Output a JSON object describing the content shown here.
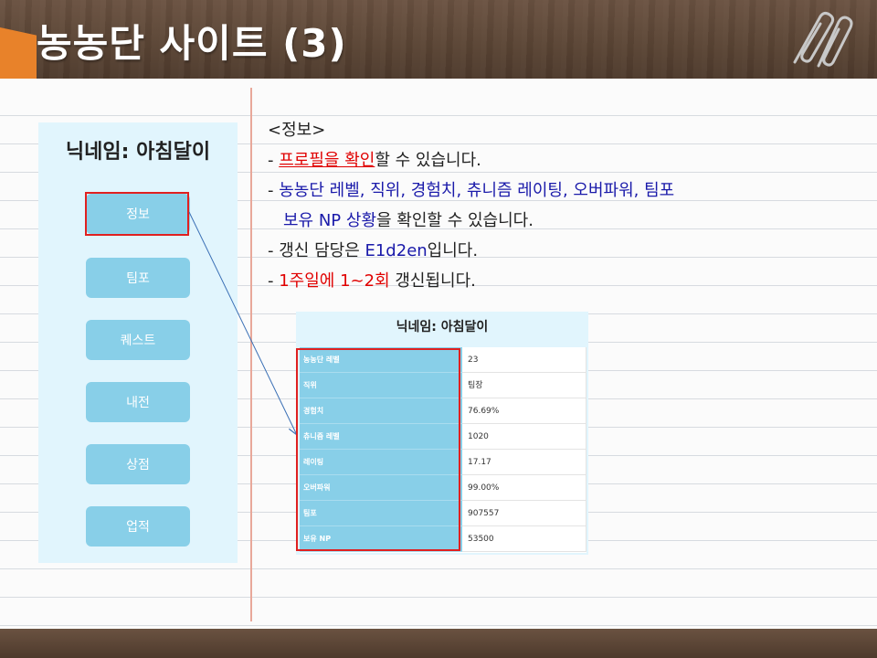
{
  "slide": {
    "title": "농농단 사이트 (3)"
  },
  "mockup": {
    "title": "닉네임: 아침달이",
    "menu": [
      {
        "label": "정보"
      },
      {
        "label": "팀포"
      },
      {
        "label": "퀘스트"
      },
      {
        "label": "내전"
      },
      {
        "label": "상점"
      },
      {
        "label": "업적"
      }
    ]
  },
  "info": {
    "heading": "<정보>",
    "bullet": "-",
    "line1": {
      "highlight": "프로필을 확인",
      "rest": "할 수 있습니다."
    },
    "line2": {
      "blue": "농농단 레벨, 직위, 경험치, 츄니즘 레이팅, 오버파워, 팀포"
    },
    "line3": {
      "blue": "보유 NP 상황",
      "rest": "을 확인할 수 있습니다."
    },
    "line4": {
      "prefix": "갱신 담당은 ",
      "blue": "E1d2en",
      "rest": "입니다."
    },
    "line5": {
      "red": "1주일에 1~2회",
      "rest": " 갱신됩니다."
    }
  },
  "profile_table": {
    "title": "닉네임: 아침달이",
    "rows": [
      {
        "label": "농농단 레벨",
        "value": "23"
      },
      {
        "label": "직위",
        "value": "팀장"
      },
      {
        "label": "경험치",
        "value": "76.69%"
      },
      {
        "label": "츄니즘 레벨",
        "value": "1020"
      },
      {
        "label": "레이팅",
        "value": "17.17"
      },
      {
        "label": "오버파워",
        "value": "99.00%"
      },
      {
        "label": "팀포",
        "value": "907557"
      },
      {
        "label": "보유 NP",
        "value": "53500"
      }
    ]
  },
  "colors": {
    "accent_red": "#e00000",
    "accent_blue": "#1a1aaa",
    "menu_button": "#88cfe8",
    "panel_bg": "#e1f5fd",
    "wood": "#5b4535",
    "ribbon": "#e8822a"
  },
  "icons": {
    "decoration": "paperclip-icon"
  }
}
